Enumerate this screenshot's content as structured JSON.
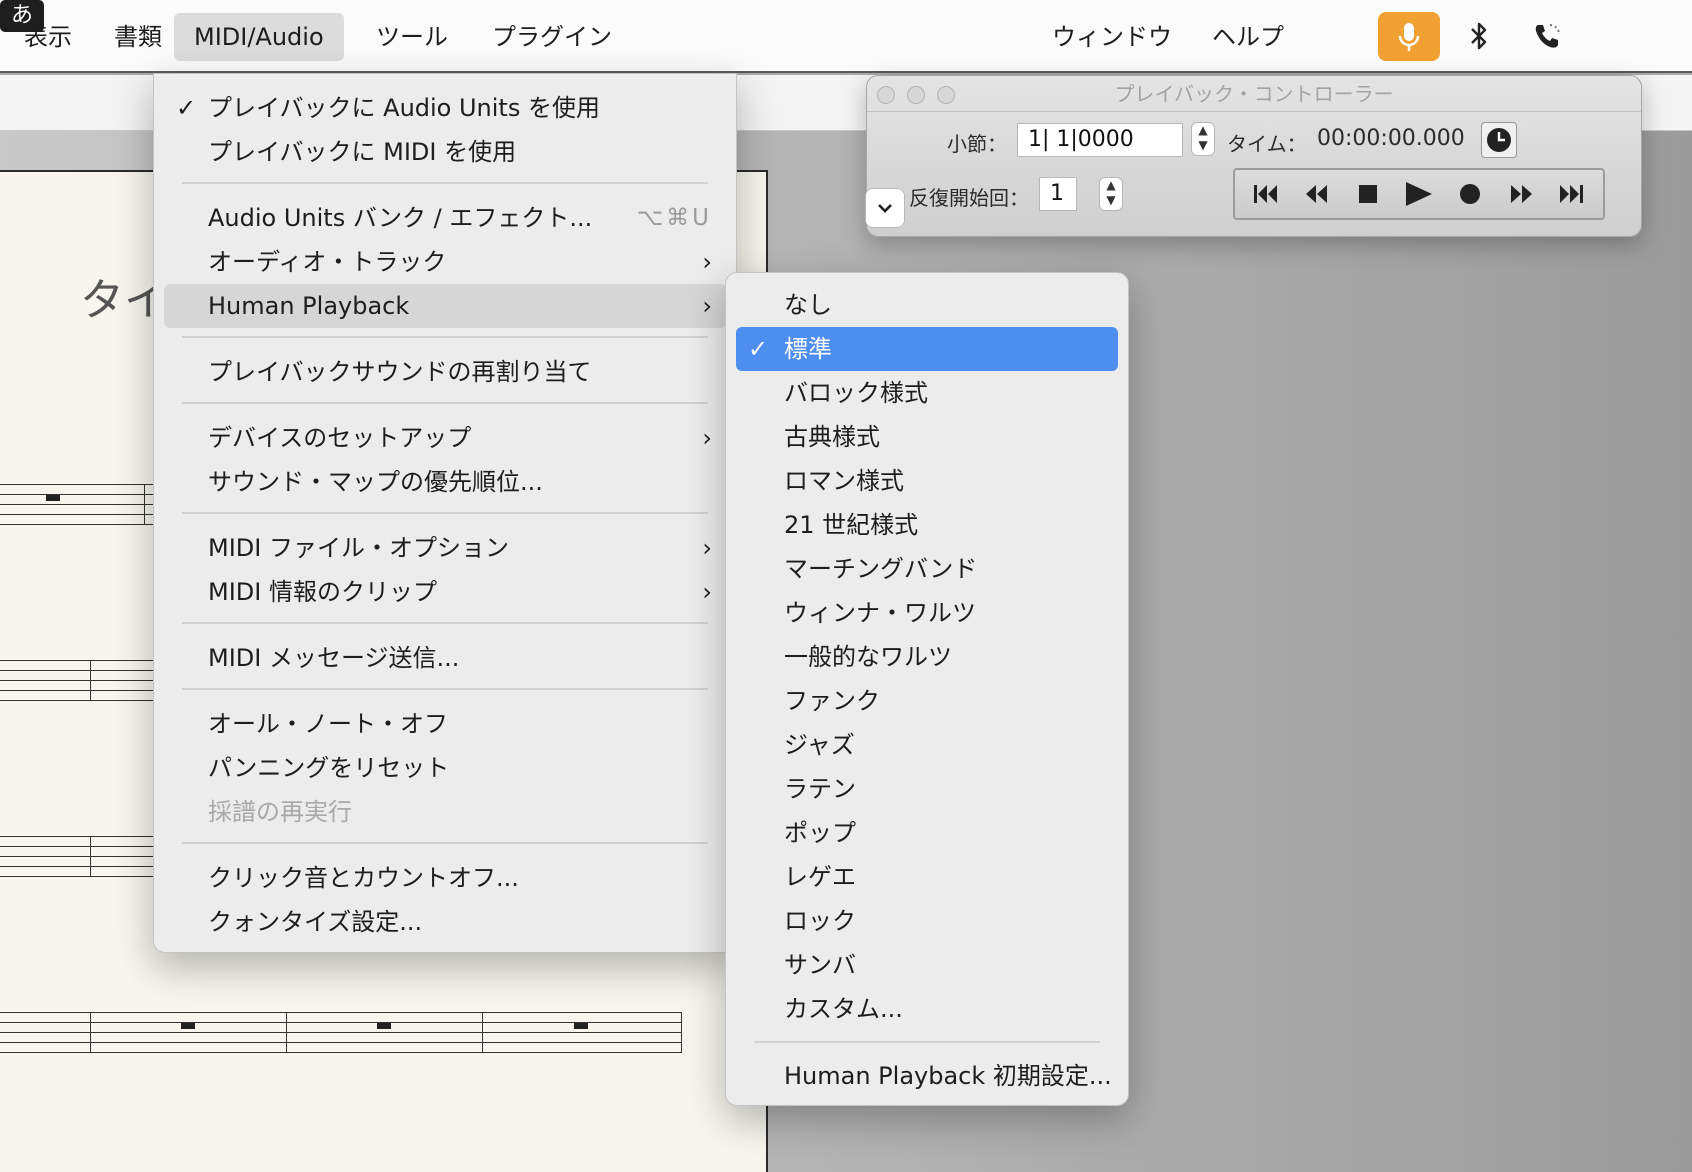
{
  "menubar": {
    "items": [
      {
        "label": "表示"
      },
      {
        "label": "書類"
      },
      {
        "label": "MIDI/Audio"
      },
      {
        "label": "ツール"
      },
      {
        "label": "プラグイン"
      },
      {
        "label": "ウィンドウ"
      },
      {
        "label": "ヘルプ"
      }
    ],
    "active_item": "MIDI/Audio",
    "status": {
      "mic_icon": "microphone-icon",
      "bluetooth_icon": "bluetooth-icon",
      "phone_icon": "phone-icon",
      "input_method_label": "あ"
    }
  },
  "score": {
    "title_fragment": "タイ"
  },
  "midi_menu": {
    "items": [
      {
        "label": "プレイバックに Audio Units を使用",
        "checked": true
      },
      {
        "label": "プレイバックに MIDI を使用"
      },
      {
        "label": "Audio Units バンク / エフェクト...",
        "shortcut": "⌥⌘U"
      },
      {
        "label": "オーディオ・トラック",
        "submenu": true
      },
      {
        "label": "Human Playback",
        "submenu": true,
        "highlighted": true
      },
      {
        "label": "プレイバックサウンドの再割り当て"
      },
      {
        "label": "デバイスのセットアップ",
        "submenu": true
      },
      {
        "label": "サウンド・マップの優先順位..."
      },
      {
        "label": "MIDI ファイル・オプション",
        "submenu": true
      },
      {
        "label": "MIDI 情報のクリップ",
        "submenu": true
      },
      {
        "label": "MIDI メッセージ送信..."
      },
      {
        "label": "オール・ノート・オフ"
      },
      {
        "label": "パンニングをリセット"
      },
      {
        "label": "採譜の再実行",
        "disabled": true
      },
      {
        "label": "クリック音とカウントオフ..."
      },
      {
        "label": "クォンタイズ設定..."
      }
    ],
    "check_glyph": "✓",
    "arrow_glyph": "›"
  },
  "human_playback_submenu": {
    "items": [
      {
        "label": "なし"
      },
      {
        "label": "標準",
        "checked": true
      },
      {
        "label": "バロック様式"
      },
      {
        "label": "古典様式"
      },
      {
        "label": "ロマン様式"
      },
      {
        "label": "21 世紀様式"
      },
      {
        "label": "マーチングバンド"
      },
      {
        "label": "ウィンナ・ワルツ"
      },
      {
        "label": "一般的なワルツ"
      },
      {
        "label": "ファンク"
      },
      {
        "label": "ジャズ"
      },
      {
        "label": "ラテン"
      },
      {
        "label": "ポップ"
      },
      {
        "label": "レゲエ"
      },
      {
        "label": "ロック"
      },
      {
        "label": "サンバ"
      },
      {
        "label": "カスタム..."
      },
      {
        "label": "Human Playback 初期設定..."
      }
    ],
    "selected_color": "#4e8ef0"
  },
  "playback_controller": {
    "title": "プレイバック・コントローラー",
    "measure_label": "小節：",
    "measure_value": "1| 1|0000",
    "time_label": "タイム：",
    "time_value": "00:00:00.000",
    "repeat_label": "反復開始回：",
    "repeat_value": "1",
    "transport_icons": [
      "skip-to-start-icon",
      "rewind-icon",
      "stop-icon",
      "play-icon",
      "record-icon",
      "fast-forward-icon",
      "skip-to-end-icon"
    ]
  },
  "colors": {
    "accent_orange": "#f0a132",
    "selection_blue": "#4e8ef0"
  }
}
